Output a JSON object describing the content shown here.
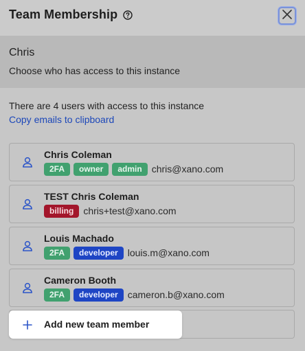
{
  "dialog": {
    "title": "Team Membership",
    "help_icon": "help-circle-icon",
    "close_icon": "close-icon"
  },
  "instance": {
    "name": "Chris",
    "description": "Choose who has access to this instance"
  },
  "summary": {
    "text": "There are 4 users with access to this instance",
    "copy_link": "Copy emails to clipboard"
  },
  "members": [
    {
      "name": "Chris Coleman",
      "badges": [
        {
          "label": "2FA",
          "color": "#41a16f"
        },
        {
          "label": "owner",
          "color": "#41a16f"
        },
        {
          "label": "admin",
          "color": "#41a16f"
        }
      ],
      "email": "chris@xano.com"
    },
    {
      "name": "TEST Chris Coleman",
      "badges": [
        {
          "label": "billing",
          "color": "#a3162b"
        }
      ],
      "email": "chris+test@xano.com"
    },
    {
      "name": "Louis Machado",
      "badges": [
        {
          "label": "2FA",
          "color": "#41a16f"
        },
        {
          "label": "developer",
          "color": "#1e45c4"
        }
      ],
      "email": "louis.m@xano.com"
    },
    {
      "name": "Cameron Booth",
      "badges": [
        {
          "label": "2FA",
          "color": "#41a16f"
        },
        {
          "label": "developer",
          "color": "#1e45c4"
        }
      ],
      "email": "cameron.b@xano.com"
    }
  ],
  "add_member": {
    "label": "Add new team member",
    "icon": "plus-icon"
  },
  "colors": {
    "link": "#1c47b9",
    "badge_green": "#41a16f",
    "badge_blue": "#1e45c4",
    "badge_red": "#a3162b",
    "user_icon": "#2c55c8"
  }
}
